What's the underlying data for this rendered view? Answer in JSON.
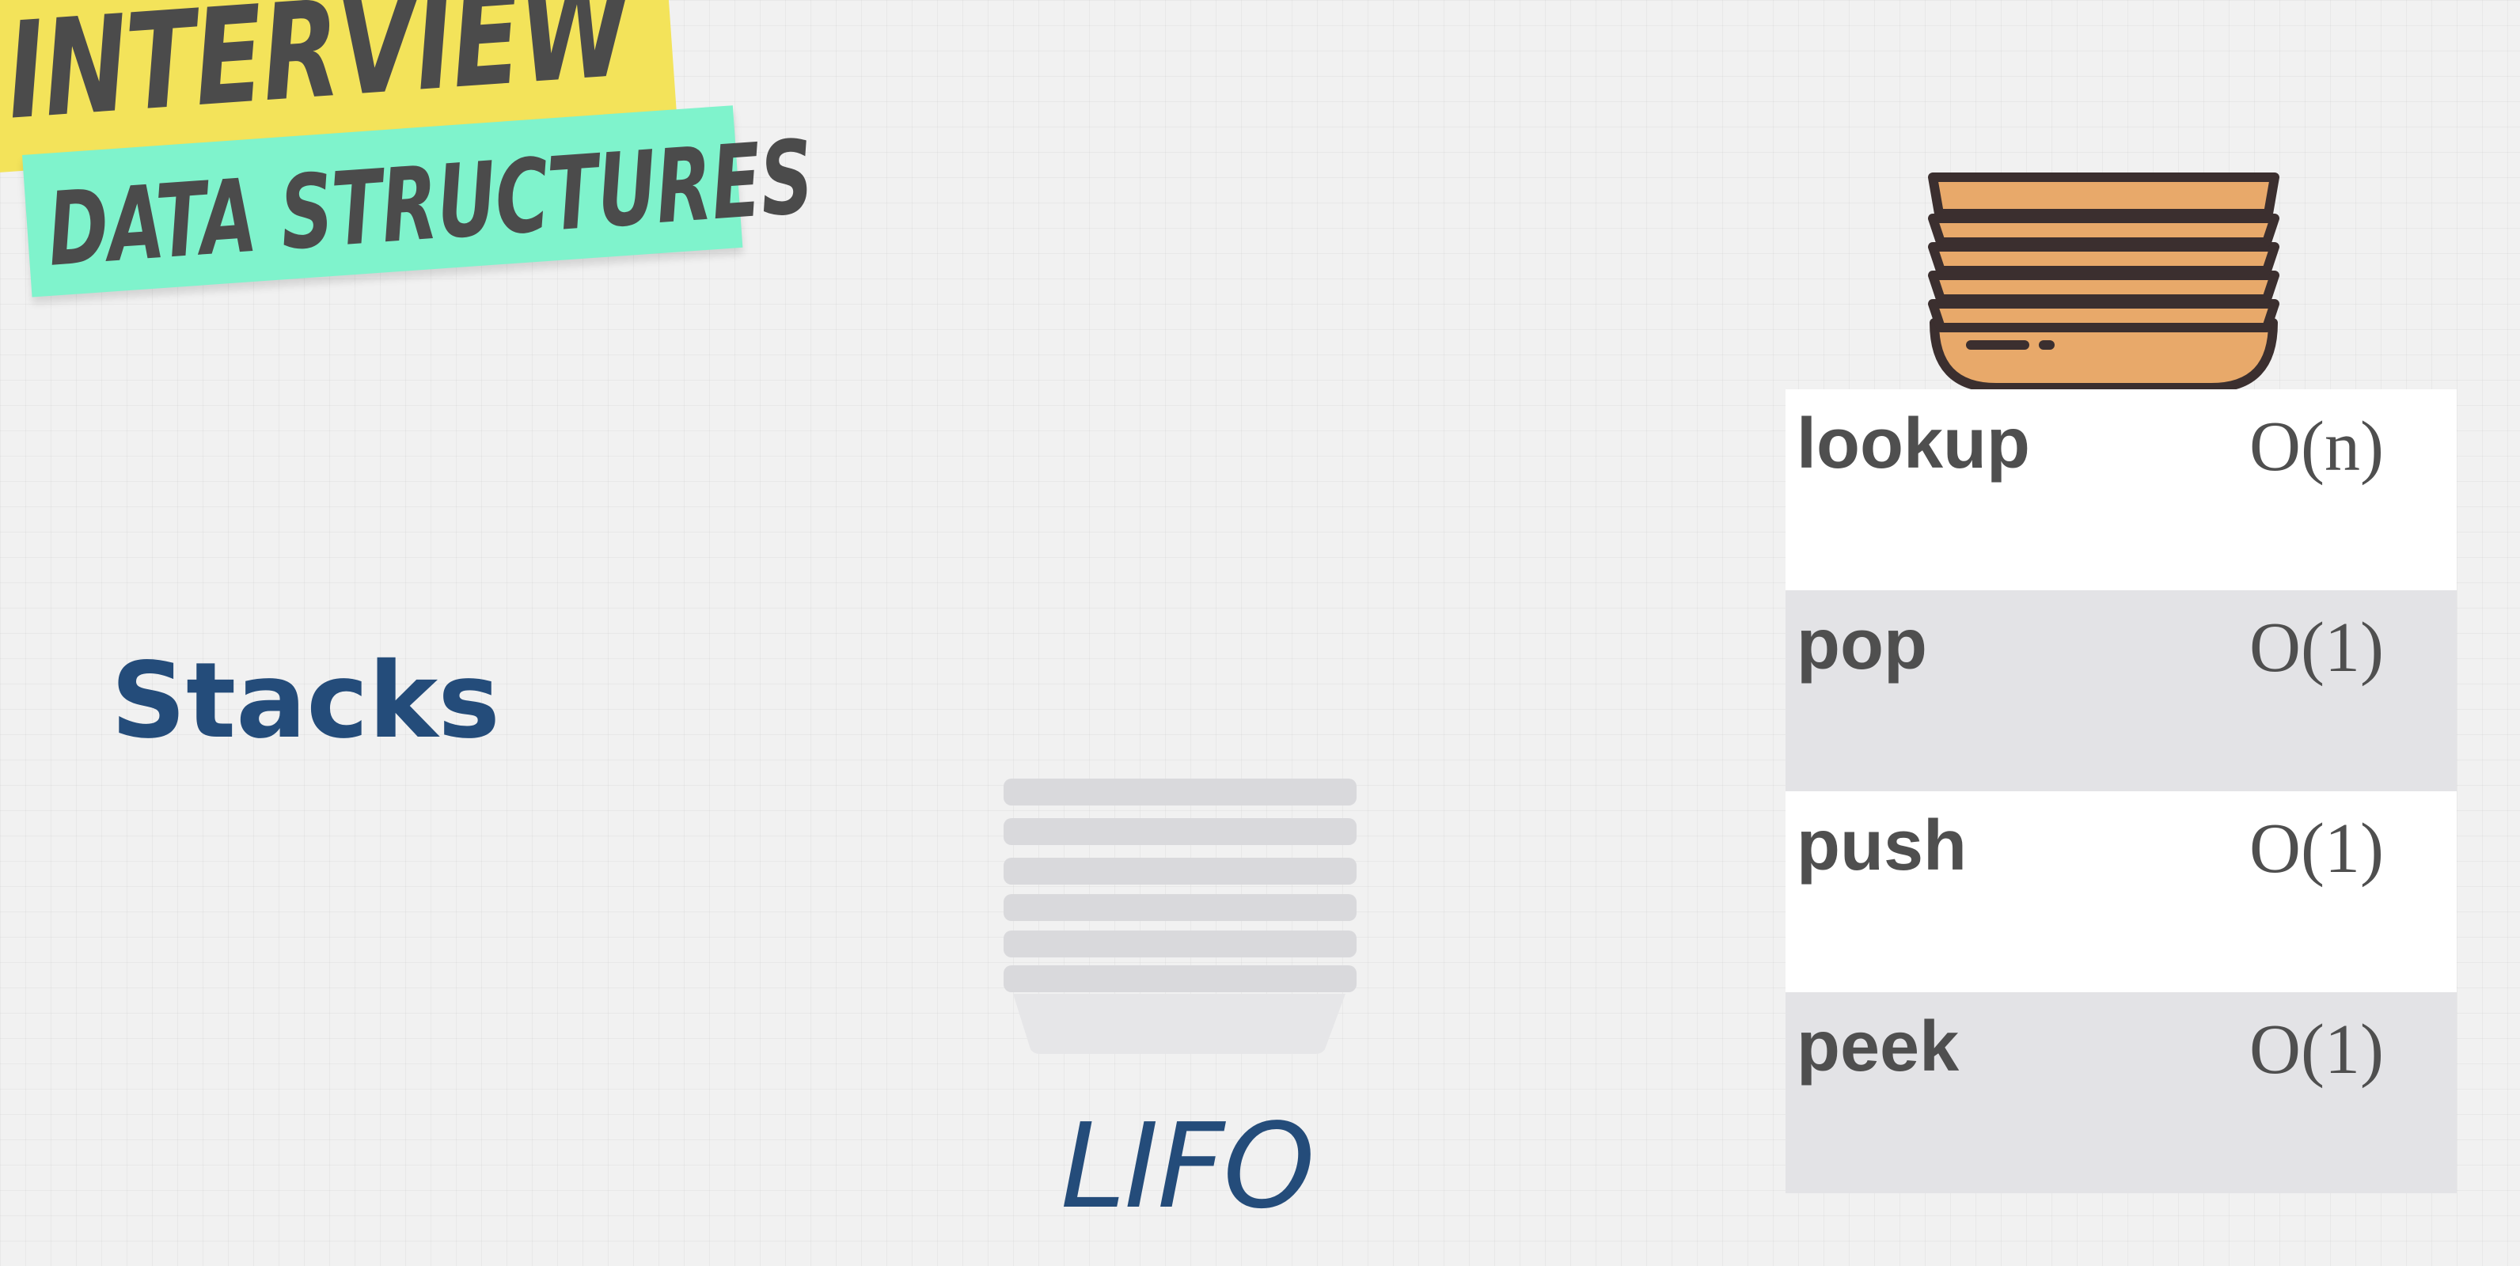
{
  "banner": {
    "line1": "INTERVIEW",
    "line2": "DATA STRUCTURES",
    "colors": {
      "yellow": "#f3e35a",
      "teal": "#7ff3cc",
      "text": "#4b4b4b"
    }
  },
  "heading": "Stacks",
  "lifo_label": "LIFO",
  "illustrations": {
    "ghost_plate_stack": "stacked-plates-icon",
    "top_plate_stack": "stacked-plates-icon"
  },
  "operations": [
    {
      "name": "lookup",
      "complexity": "O(n)"
    },
    {
      "name": "pop",
      "complexity": "O(1)"
    },
    {
      "name": "push",
      "complexity": "O(1)"
    },
    {
      "name": "peek",
      "complexity": "O(1)"
    }
  ],
  "colors": {
    "accent": "#244c7a",
    "plate_fill": "#e8a96a",
    "plate_outline": "#3b2f2f",
    "ghost_plate": "#d9d9dc",
    "row_alt": "#e3e3e6"
  }
}
